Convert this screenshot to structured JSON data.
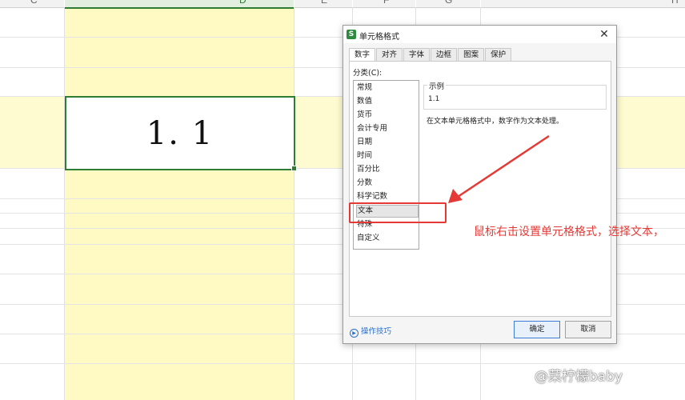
{
  "sheet": {
    "columns": [
      {
        "label": "C"
      },
      {
        "label": "D"
      },
      {
        "label": "E"
      },
      {
        "label": "F"
      },
      {
        "label": "G"
      },
      {
        "label": "H"
      }
    ],
    "active_cell_value": "1. 1",
    "colors": {
      "active": "#2e7d32",
      "highlight": "#fff9c4"
    }
  },
  "dialog": {
    "title": "单元格格式",
    "app_icon_letter": "S",
    "close_icon": "close-icon",
    "tabs": [
      {
        "label": "数字"
      },
      {
        "label": "对齐"
      },
      {
        "label": "字体"
      },
      {
        "label": "边框"
      },
      {
        "label": "图案"
      },
      {
        "label": "保护"
      }
    ],
    "active_tab": "数字",
    "category_label": "分类(C):",
    "categories": [
      {
        "label": "常规"
      },
      {
        "label": "数值"
      },
      {
        "label": "货币"
      },
      {
        "label": "会计专用"
      },
      {
        "label": "日期"
      },
      {
        "label": "时间"
      },
      {
        "label": "百分比"
      },
      {
        "label": "分数"
      },
      {
        "label": "科学记数"
      },
      {
        "label": "文本"
      },
      {
        "label": "特殊"
      },
      {
        "label": "自定义"
      }
    ],
    "selected_category": "文本",
    "example_label": "示例",
    "example_value": "1.1",
    "description": "在文本单元格格式中，数字作为文本处理。",
    "help_link": "操作技巧",
    "ok_label": "确定",
    "cancel_label": "取消"
  },
  "annotation": {
    "text": "鼠标右击设置单元格格式，选择文本，",
    "color": "#e53935"
  },
  "watermark": "@菜柠檬baby"
}
